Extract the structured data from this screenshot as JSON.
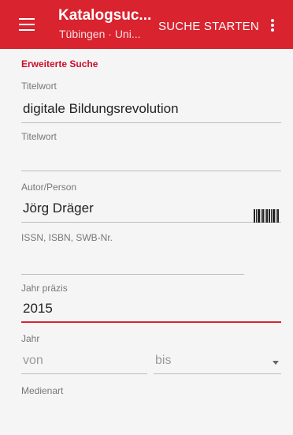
{
  "toolbar": {
    "title": "Katalogsuc...",
    "subtitle": "Tübingen · Uni...",
    "action_label": "SUCHE STARTEN",
    "background_color": "#d9232f",
    "menu_icon": "hamburger-menu-icon",
    "overflow_icon": "more-vert-icon"
  },
  "form": {
    "section_title": "Erweiterte Suche",
    "fields": {
      "titelwort1": {
        "label": "Titelwort",
        "value": "digitale Bildungsrevolution"
      },
      "titelwort2": {
        "label": "Titelwort",
        "value": ""
      },
      "autor": {
        "label": "Autor/Person",
        "value": "Jörg Dräger"
      },
      "issn": {
        "label": "ISSN, ISBN, SWB-Nr.",
        "value": "",
        "icon": "barcode-scan-icon"
      },
      "jahr_praezis": {
        "label": "Jahr präzis",
        "value": "2015"
      },
      "jahr": {
        "label": "Jahr",
        "from_placeholder": "von",
        "to_placeholder": "bis"
      },
      "medienart": {
        "label": "Medienart",
        "value": "",
        "icon": "dropdown-arrow-icon"
      }
    },
    "accent_color": "#c8102e"
  }
}
